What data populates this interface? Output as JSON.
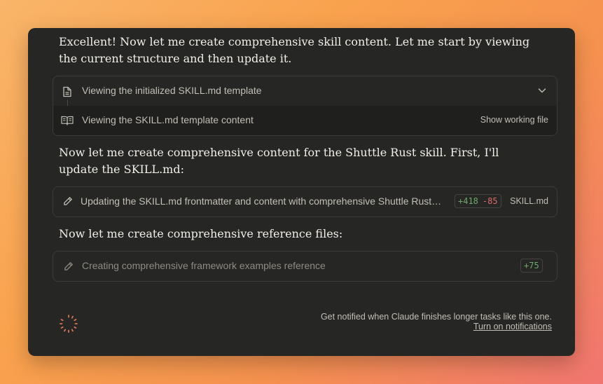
{
  "messages": {
    "intro": "Excellent! Now let me create comprehensive skill content. Let me start by viewing the current structure and then update it.",
    "middle": "Now let me create comprehensive content for the Shuttle Rust skill. First, I'll update the SKILL.md:",
    "refs": "Now let me create comprehensive reference files:"
  },
  "tool_group": {
    "row1": {
      "icon": "document-icon",
      "label": "Viewing the initialized SKILL.md template"
    },
    "row2": {
      "icon": "book-icon",
      "label": "Viewing the SKILL.md template content",
      "action": "Show working file"
    }
  },
  "update_tool": {
    "icon": "pencil-icon",
    "label": "Updating the SKILL.md frontmatter and content with comprehensive Shuttle Rust…",
    "added": "+418",
    "removed": "-85",
    "file": "SKILL.md"
  },
  "create_tool": {
    "icon": "pencil-icon",
    "label": "Creating comprehensive framework examples reference",
    "added": "+75"
  },
  "notification": {
    "text": "Get notified when Claude finishes longer tasks like this one.",
    "link": "Turn on notifications"
  },
  "colors": {
    "panel": "#262624",
    "spinner": "#d97757",
    "diff_add": "#6ea86b",
    "diff_remove": "#dc6a6a"
  }
}
